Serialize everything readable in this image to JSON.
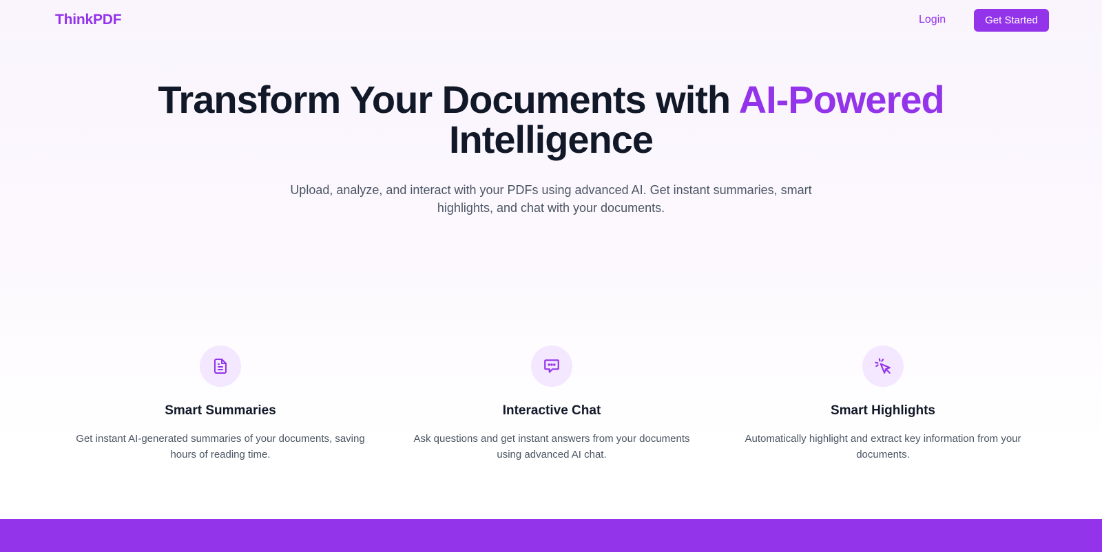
{
  "nav": {
    "logo": "ThinkPDF",
    "login_label": "Login",
    "cta_label": "Get Started"
  },
  "hero": {
    "title_part1": "Transform Your Documents with ",
    "title_accent": "AI-Powered",
    "title_part2": "Intelligence",
    "subtitle": "Upload, analyze, and interact with your PDFs using advanced AI. Get instant summaries, smart highlights, and chat with your documents."
  },
  "features": [
    {
      "icon": "document-icon",
      "title": "Smart Summaries",
      "description": "Get instant AI-generated summaries of your documents, saving hours of reading time."
    },
    {
      "icon": "chat-icon",
      "title": "Interactive Chat",
      "description": "Ask questions and get instant answers from your documents using advanced AI chat."
    },
    {
      "icon": "cursor-click-icon",
      "title": "Smart Highlights",
      "description": "Automatically highlight and extract key information from your documents."
    }
  ],
  "colors": {
    "accent": "#9333ea",
    "icon_bg": "#f3e8ff",
    "heading": "#111827",
    "body_text": "#4b5563"
  }
}
